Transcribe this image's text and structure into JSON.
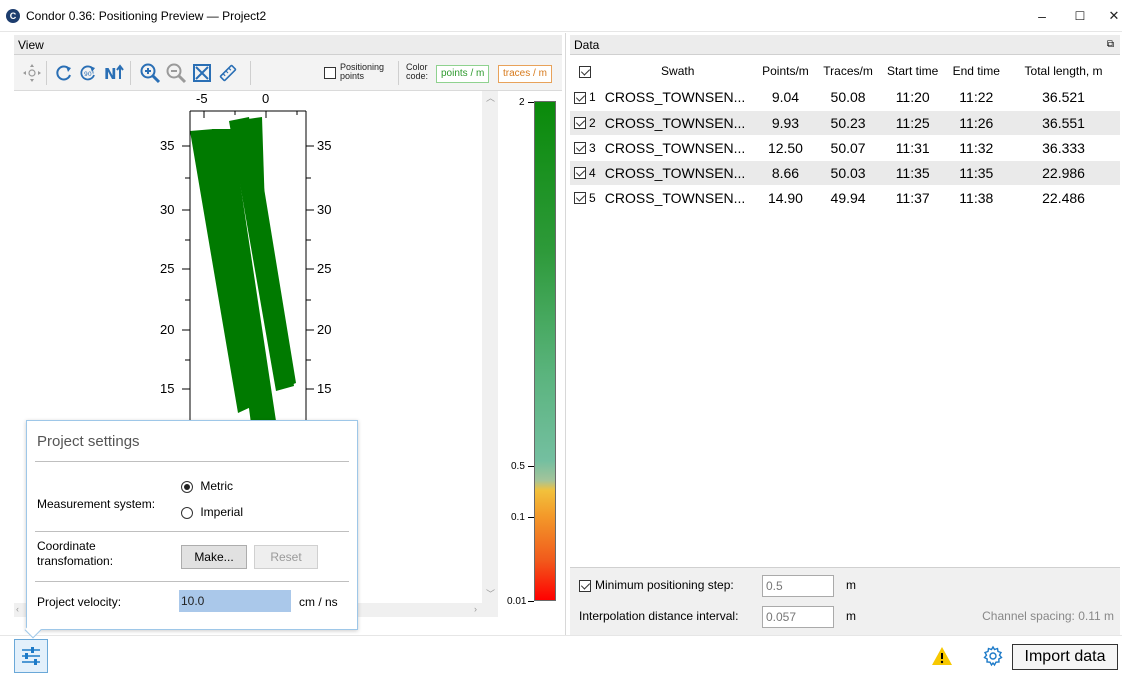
{
  "window": {
    "app_icon": "C",
    "title": "Condor 0.36: Positioning Preview — Project2",
    "minimize": "–",
    "maximize": "☐",
    "close": "✕"
  },
  "view_panel": {
    "header": "View",
    "positioning_points": {
      "label_line1": "Positioning",
      "label_line2": "points",
      "checked": false
    },
    "color_code": {
      "label_line1": "Color",
      "label_line2": "code:",
      "points_label": "points / m",
      "traces_label": "traces / m"
    },
    "icons": [
      "move-icon",
      "rotate-cw-icon",
      "rotate-90-icon",
      "north-up-icon",
      "zoom-in-icon",
      "zoom-out-icon",
      "fit-extent-icon",
      "ruler-icon"
    ]
  },
  "plot": {
    "x_ticks": [
      "-5",
      "0"
    ],
    "y_ticks": [
      "35",
      "30",
      "25",
      "20",
      "15"
    ],
    "swath_color": "#007a00"
  },
  "color_scale": {
    "ticks": [
      "2",
      "0.5",
      "0.1",
      "0.01"
    ]
  },
  "data_panel": {
    "header": "Data",
    "undock_icon": "window-restore-icon",
    "columns": [
      "Swath",
      "Points/m",
      "Traces/m",
      "Start time",
      "End time",
      "Total length, m"
    ],
    "rows": [
      {
        "num": "1",
        "checked": true,
        "swath": "CROSS_TOWNSEN...",
        "points": "9.04",
        "traces": "50.08",
        "start": "11:20",
        "end": "11:22",
        "length": "36.521"
      },
      {
        "num": "2",
        "checked": true,
        "swath": "CROSS_TOWNSEN...",
        "points": "9.93",
        "traces": "50.23",
        "start": "11:25",
        "end": "11:26",
        "length": "36.551"
      },
      {
        "num": "3",
        "checked": true,
        "swath": "CROSS_TOWNSEN...",
        "points": "12.50",
        "traces": "50.07",
        "start": "11:31",
        "end": "11:32",
        "length": "36.333"
      },
      {
        "num": "4",
        "checked": true,
        "swath": "CROSS_TOWNSEN...",
        "points": "8.66",
        "traces": "50.03",
        "start": "11:35",
        "end": "11:35",
        "length": "22.986"
      },
      {
        "num": "5",
        "checked": true,
        "swath": "CROSS_TOWNSEN...",
        "points": "14.90",
        "traces": "49.94",
        "start": "11:37",
        "end": "11:38",
        "length": "22.486"
      }
    ]
  },
  "options": {
    "min_step_label": "Minimum positioning step:",
    "min_step_checked": true,
    "min_step_value": "0.5",
    "min_step_unit": "m",
    "interp_label": "Interpolation distance interval:",
    "interp_value": "0.057",
    "interp_unit": "m",
    "channel_spacing": "Channel spacing: 0.11 m"
  },
  "project_settings": {
    "title": "Project settings",
    "measurement_label": "Measurement system:",
    "metric": "Metric",
    "imperial": "Imperial",
    "measurement_selected": "Metric",
    "coord_label_line1": "Coordinate",
    "coord_label_line2": "transfomation:",
    "make_button": "Make...",
    "reset_button": "Reset",
    "velocity_label": "Project velocity:",
    "velocity_value": "10.0",
    "velocity_unit": "cm / ns"
  },
  "status": {
    "import_button": "Import data",
    "warning_icon": "warning-icon",
    "settings_icon": "gear-icon",
    "project_settings_icon": "sliders-icon"
  }
}
